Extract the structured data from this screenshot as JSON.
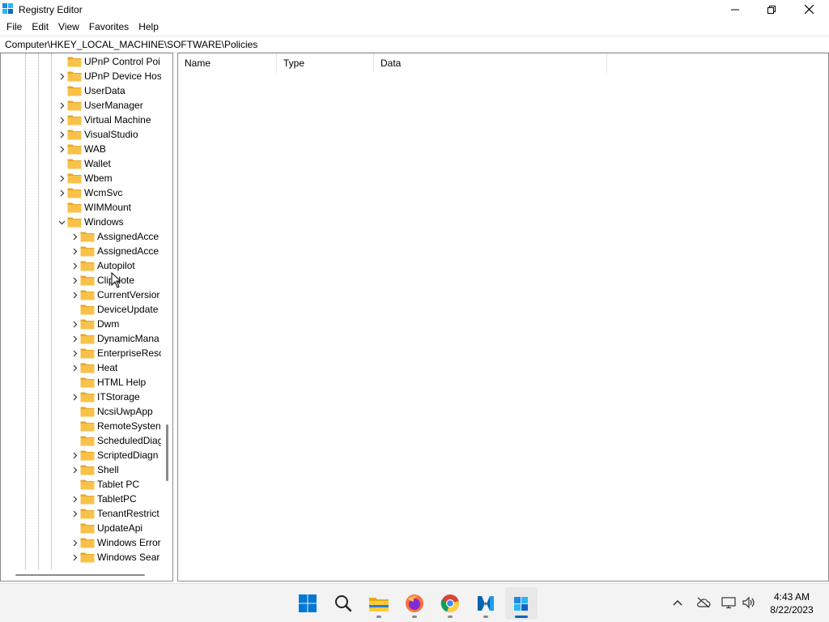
{
  "window": {
    "title": "Registry Editor",
    "icon": "registry-editor-icon",
    "controls": {
      "minimize": "minimize-icon",
      "maximize": "restore-icon",
      "close": "close-icon"
    }
  },
  "menu": {
    "items": [
      "File",
      "Edit",
      "View",
      "Favorites",
      "Help"
    ]
  },
  "address": {
    "path": "Computer\\HKEY_LOCAL_MACHINE\\SOFTWARE\\Policies"
  },
  "tree": {
    "items": [
      {
        "label": "UPnP Control Poi",
        "level": 1,
        "expander": "none"
      },
      {
        "label": "UPnP Device Hos",
        "level": 1,
        "expander": "collapsed"
      },
      {
        "label": "UserData",
        "level": 1,
        "expander": "none"
      },
      {
        "label": "UserManager",
        "level": 1,
        "expander": "collapsed"
      },
      {
        "label": "Virtual Machine",
        "level": 1,
        "expander": "collapsed"
      },
      {
        "label": "VisualStudio",
        "level": 1,
        "expander": "collapsed"
      },
      {
        "label": "WAB",
        "level": 1,
        "expander": "collapsed"
      },
      {
        "label": "Wallet",
        "level": 1,
        "expander": "none"
      },
      {
        "label": "Wbem",
        "level": 1,
        "expander": "collapsed"
      },
      {
        "label": "WcmSvc",
        "level": 1,
        "expander": "collapsed"
      },
      {
        "label": "WIMMount",
        "level": 1,
        "expander": "none"
      },
      {
        "label": "Windows",
        "level": 1,
        "expander": "expanded"
      },
      {
        "label": "AssignedAcce",
        "level": 2,
        "expander": "collapsed"
      },
      {
        "label": "AssignedAcce",
        "level": 2,
        "expander": "collapsed"
      },
      {
        "label": "Autopilot",
        "level": 2,
        "expander": "collapsed"
      },
      {
        "label": "ClipNote",
        "level": 2,
        "expander": "collapsed"
      },
      {
        "label": "CurrentVersior",
        "level": 2,
        "expander": "collapsed"
      },
      {
        "label": "DeviceUpdate",
        "level": 2,
        "expander": "none"
      },
      {
        "label": "Dwm",
        "level": 2,
        "expander": "collapsed"
      },
      {
        "label": "DynamicMana",
        "level": 2,
        "expander": "collapsed"
      },
      {
        "label": "EnterpriseResc",
        "level": 2,
        "expander": "collapsed"
      },
      {
        "label": "Heat",
        "level": 2,
        "expander": "collapsed"
      },
      {
        "label": "HTML Help",
        "level": 2,
        "expander": "none"
      },
      {
        "label": "ITStorage",
        "level": 2,
        "expander": "collapsed"
      },
      {
        "label": "NcsiUwpApp",
        "level": 2,
        "expander": "none"
      },
      {
        "label": "RemoteSysten",
        "level": 2,
        "expander": "none"
      },
      {
        "label": "ScheduledDiag",
        "level": 2,
        "expander": "none"
      },
      {
        "label": "ScriptedDiagn",
        "level": 2,
        "expander": "collapsed"
      },
      {
        "label": "Shell",
        "level": 2,
        "expander": "collapsed"
      },
      {
        "label": "Tablet PC",
        "level": 2,
        "expander": "none"
      },
      {
        "label": "TabletPC",
        "level": 2,
        "expander": "collapsed"
      },
      {
        "label": "TenantRestrict",
        "level": 2,
        "expander": "collapsed"
      },
      {
        "label": "UpdateApi",
        "level": 2,
        "expander": "none"
      },
      {
        "label": "Windows Error",
        "level": 2,
        "expander": "collapsed"
      },
      {
        "label": "Windows Sear",
        "level": 2,
        "expander": "collapsed"
      }
    ]
  },
  "list": {
    "columns": [
      "Name",
      "Type",
      "Data"
    ]
  },
  "taskbar": {
    "apps": [
      {
        "name": "windows-start-icon",
        "active": false
      },
      {
        "name": "search-icon",
        "active": false
      },
      {
        "name": "file-explorer-icon",
        "active": false
      },
      {
        "name": "firefox-icon",
        "active": false
      },
      {
        "name": "chrome-icon",
        "active": false
      },
      {
        "name": "visual-studio-code-icon",
        "active": false
      },
      {
        "name": "registry-editor-icon",
        "active": true
      }
    ],
    "tray": [
      "chevron-up-icon",
      "cloud-offline-icon",
      "network-icon",
      "volume-icon"
    ],
    "time": "4:43 AM",
    "date": "8/22/2023"
  },
  "colors": {
    "folder": "#f8c24a",
    "folder_dark": "#e7a623",
    "accent": "#0067c0"
  }
}
